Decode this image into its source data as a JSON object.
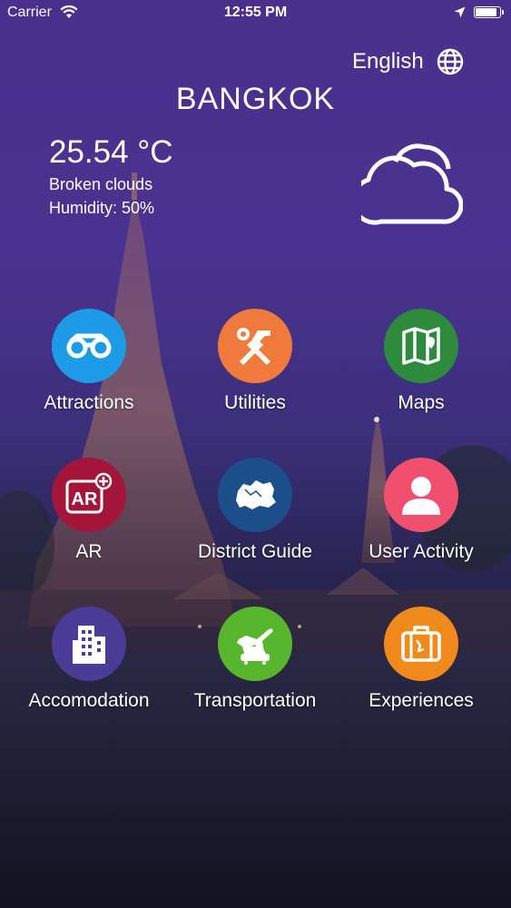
{
  "status_bar": {
    "carrier": "Carrier",
    "time": "12:55 PM",
    "battery_level": 0.95
  },
  "header": {
    "language": "English",
    "globe_icon": "globe-icon",
    "city": "BANGKOK"
  },
  "weather": {
    "temperature": "25.54 °C",
    "condition": "Broken clouds",
    "humidity": "Humidity: 50%",
    "icon": "cloud-icon"
  },
  "menu": {
    "items": [
      {
        "label": "Attractions",
        "icon": "binoculars-icon",
        "color": "#1e9be6"
      },
      {
        "label": "Utilities",
        "icon": "tools-icon",
        "color": "#f07a3c"
      },
      {
        "label": "Maps",
        "icon": "map-icon",
        "color": "#2e8b3e"
      },
      {
        "label": "AR",
        "icon": "ar-icon",
        "color": "#a3163a"
      },
      {
        "label": "District Guide",
        "icon": "district-map-icon",
        "color": "#1c4f8a"
      },
      {
        "label": "User Activity",
        "icon": "user-icon",
        "color": "#f0506e"
      },
      {
        "label": "Accomodation",
        "icon": "building-icon",
        "color": "#4b3d97"
      },
      {
        "label": "Transportation",
        "icon": "plane-car-icon",
        "color": "#58b52e"
      },
      {
        "label": "Experiences",
        "icon": "luggage-icon",
        "color": "#f08a1c"
      }
    ]
  }
}
